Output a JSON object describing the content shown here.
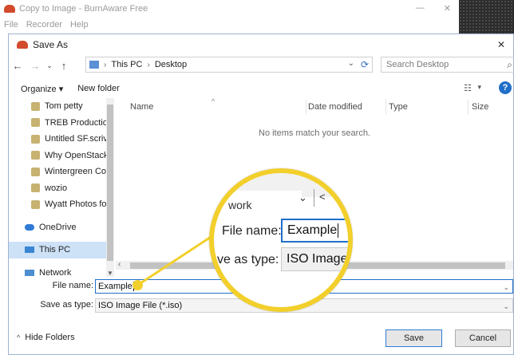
{
  "background_window": {
    "title": "Copy to Image - BurnAware Free",
    "menu": [
      "File",
      "Recorder",
      "Help"
    ],
    "controls": [
      "—",
      "✕"
    ]
  },
  "dialog": {
    "title": "Save As",
    "close_glyph": "✕",
    "address": {
      "segments": [
        "This PC",
        "Desktop"
      ],
      "separator": "›"
    },
    "search": {
      "placeholder": "Search Desktop"
    },
    "toolbar": {
      "organize": "Organize ▾",
      "new_folder": "New folder"
    },
    "nav_pane": {
      "items": [
        {
          "label": "Tom petty"
        },
        {
          "label": "TREB Production"
        },
        {
          "label": "Untitled SF.scriv"
        },
        {
          "label": "Why OpenStack"
        },
        {
          "label": "Wintergreen Cor"
        },
        {
          "label": "wozio"
        },
        {
          "label": "Wyatt Photos for"
        }
      ],
      "onedrive": "OneDrive",
      "this_pc": "This PC",
      "network": "Network"
    },
    "columns": [
      "Name",
      "Date modified",
      "Type",
      "Size"
    ],
    "empty_message": "No items match your search.",
    "file_name_label": "File name:",
    "file_name_value": "Example",
    "save_type_label": "Save as type:",
    "save_type_value": "ISO Image File (*.iso)",
    "hide_folders": "Hide Folders",
    "save_button": "Save",
    "cancel_button": "Cancel"
  },
  "magnifier": {
    "top_text": "work",
    "file_name_label": "File name:",
    "file_name_value": "Example",
    "type_label": "ve as type:",
    "type_value": "ISO Image"
  },
  "colors": {
    "callout": "#f2cf2b",
    "accent": "#1f6fc9",
    "selection": "#cde1f7"
  }
}
